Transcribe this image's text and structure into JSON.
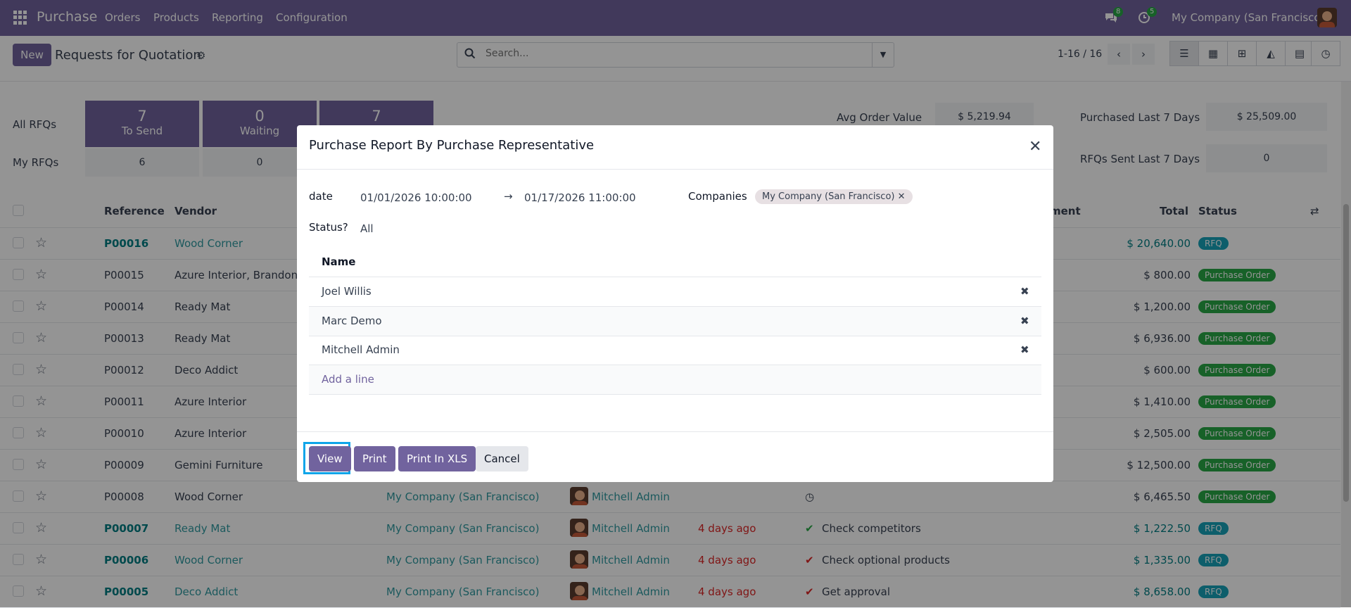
{
  "topbar": {
    "app_name": "Purchase",
    "menu": [
      "Orders",
      "Products",
      "Reporting",
      "Configuration"
    ],
    "messages_count": "8",
    "activities_count": "5",
    "company": "My Company (San Francisco)"
  },
  "control": {
    "new_label": "New",
    "title": "Requests for Quotation",
    "search_placeholder": "Search...",
    "pager": "1-16 / 16"
  },
  "dashboard": {
    "all_rfqs_label": "All RFQs",
    "my_rfqs_label": "My RFQs",
    "tiles": [
      {
        "value": "7",
        "label": "To Send"
      },
      {
        "value": "0",
        "label": "Waiting"
      },
      {
        "value": "7",
        "label": ""
      }
    ],
    "my_values": [
      "6",
      "0"
    ],
    "avg_order_value_label": "Avg Order Value",
    "avg_order_value": "$ 5,219.94",
    "purchased_last_7_label": "Purchased Last 7 Days",
    "purchased_last_7": "$ 25,509.00",
    "rfqs_sent_label": "RFQs Sent Last 7 Days",
    "rfqs_sent": "0"
  },
  "table": {
    "headers": {
      "reference": "Reference",
      "vendor": "Vendor",
      "activity": "ment",
      "total": "Total",
      "status": "Status"
    },
    "rows": [
      {
        "ref": "P00016",
        "vendor": "Wood Corner",
        "company": "",
        "buyer": "",
        "deadline": "",
        "activity": "",
        "total": "$ 20,640.00",
        "status": "RFQ"
      },
      {
        "ref": "P00015",
        "vendor": "Azure Interior, Brandon F",
        "company": "",
        "buyer": "",
        "deadline": "",
        "activity": "",
        "total": "$ 800.00",
        "status": "Purchase Order"
      },
      {
        "ref": "P00014",
        "vendor": "Ready Mat",
        "company": "",
        "buyer": "",
        "deadline": "",
        "activity": "",
        "total": "$ 1,200.00",
        "status": "Purchase Order"
      },
      {
        "ref": "P00013",
        "vendor": "Ready Mat",
        "company": "",
        "buyer": "",
        "deadline": "",
        "activity": "",
        "total": "$ 6,936.00",
        "status": "Purchase Order"
      },
      {
        "ref": "P00012",
        "vendor": "Deco Addict",
        "company": "",
        "buyer": "",
        "deadline": "",
        "activity": "",
        "total": "$ 600.00",
        "status": "Purchase Order"
      },
      {
        "ref": "P00011",
        "vendor": "Azure Interior",
        "company": "",
        "buyer": "",
        "deadline": "",
        "activity": "",
        "total": "$ 1,410.00",
        "status": "Purchase Order"
      },
      {
        "ref": "P00010",
        "vendor": "Azure Interior",
        "company": "",
        "buyer": "",
        "deadline": "",
        "activity": "",
        "total": "$ 2,505.00",
        "status": "Purchase Order"
      },
      {
        "ref": "P00009",
        "vendor": "Gemini Furniture",
        "company": "",
        "buyer": "",
        "deadline": "",
        "activity": "",
        "total": "$ 12,500.00",
        "status": "Purchase Order"
      },
      {
        "ref": "P00008",
        "vendor": "Wood Corner",
        "company": "My Company (San Francisco)",
        "buyer": "Mitchell Admin",
        "deadline": "",
        "activity": "",
        "total": "$ 6,465.50",
        "status": "Purchase Order"
      },
      {
        "ref": "P00007",
        "vendor": "Ready Mat",
        "company": "My Company (San Francisco)",
        "buyer": "Mitchell Admin",
        "deadline": "4 days ago",
        "activity": "Check competitors",
        "total": "$ 1,222.50",
        "status": "RFQ"
      },
      {
        "ref": "P00006",
        "vendor": "Wood Corner",
        "company": "My Company (San Francisco)",
        "buyer": "Mitchell Admin",
        "deadline": "4 days ago",
        "activity": "Check optional products",
        "total": "$ 1,335.00",
        "status": "RFQ"
      },
      {
        "ref": "P00005",
        "vendor": "Deco Addict",
        "company": "My Company (San Francisco)",
        "buyer": "Mitchell Admin",
        "deadline": "4 days ago",
        "activity": "Get approval",
        "total": "$ 8,658.00",
        "status": "RFQ"
      }
    ]
  },
  "modal": {
    "title": "Purchase Report By Purchase Representative",
    "date_label": "date",
    "date_from": "01/01/2026 10:00:00",
    "date_to": "01/17/2026 11:00:00",
    "companies_label": "Companies",
    "company_tag": "My Company (San Francisco)",
    "status_label": "Status?",
    "status_value": "All",
    "name_header": "Name",
    "reps": [
      "Joel Willis",
      "Marc Demo",
      "Mitchell Admin"
    ],
    "add_line": "Add a line",
    "buttons": {
      "view": "View",
      "print": "Print",
      "print_xls": "Print In XLS",
      "cancel": "Cancel"
    }
  }
}
